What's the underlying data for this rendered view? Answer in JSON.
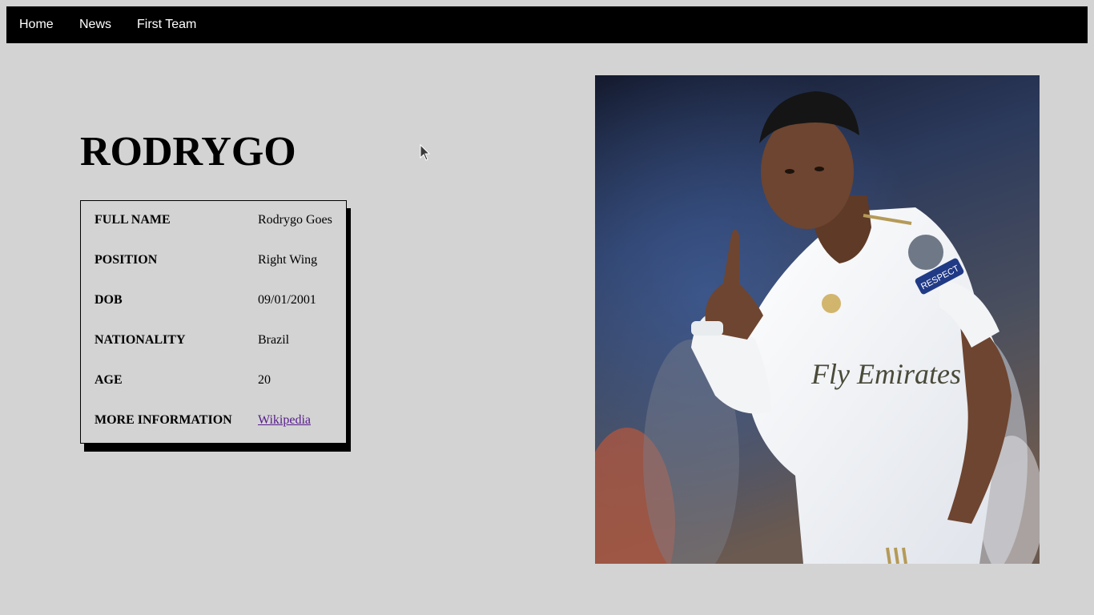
{
  "nav": {
    "items": [
      "Home",
      "News",
      "First Team"
    ]
  },
  "player": {
    "name": "RODRYGO",
    "rows": [
      {
        "label": "FULL NAME",
        "value": "Rodrygo Goes"
      },
      {
        "label": "POSITION",
        "value": "Right Wing"
      },
      {
        "label": "DOB",
        "value": "09/01/2001"
      },
      {
        "label": "NATIONALITY",
        "value": "Brazil"
      },
      {
        "label": "AGE",
        "value": "20"
      },
      {
        "label": "MORE INFORMATION",
        "value": "Wikipedia"
      }
    ]
  },
  "photo": {
    "shirt_text": "Fly Emirates",
    "sleeve_text": "RESPECT"
  },
  "colors": {
    "background": "#d3d3d3",
    "nav": "#000000",
    "link": "#551a8b",
    "kit": "#ffffff",
    "trim": "#b59a57"
  }
}
